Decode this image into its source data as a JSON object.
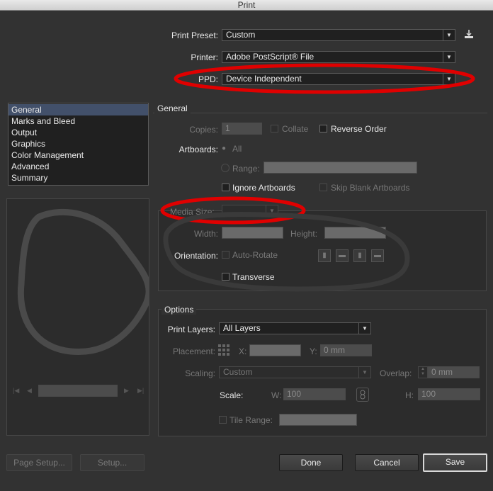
{
  "window": {
    "title": "Print"
  },
  "top": {
    "print_preset_label": "Print Preset:",
    "print_preset_value": "Custom",
    "printer_label": "Printer:",
    "printer_value": "Adobe PostScript® File",
    "ppd_label": "PPD:",
    "ppd_value": "Device Independent"
  },
  "sidebar": {
    "items": [
      "General",
      "Marks and Bleed",
      "Output",
      "Graphics",
      "Color Management",
      "Advanced",
      "Summary"
    ],
    "selected": "General"
  },
  "general": {
    "section_title": "General",
    "copies_label": "Copies:",
    "copies_value": "1",
    "collate_label": "Collate",
    "reverse_order_label": "Reverse Order",
    "artboards_label": "Artboards:",
    "all_label": "All",
    "range_label": "Range:",
    "ignore_artboards_label": "Ignore Artboards",
    "skip_blank_label": "Skip Blank Artboards",
    "media_size_label": "Media Size:",
    "width_label": "Width:",
    "height_label": "Height:",
    "orientation_label": "Orientation:",
    "auto_rotate_label": "Auto-Rotate",
    "transverse_label": "Transverse"
  },
  "options": {
    "section_title": "Options",
    "print_layers_label": "Print Layers:",
    "print_layers_value": "All Layers",
    "placement_label": "Placement:",
    "x_label": "X:",
    "y_label": "Y:",
    "y_value": "0 mm",
    "scaling_label": "Scaling:",
    "scaling_value": "Custom",
    "overlap_label": "Overlap:",
    "overlap_value": "0 mm",
    "scale_label": "Scale:",
    "w_label": "W:",
    "w_value": "100",
    "h_label": "H:",
    "h_value": "100",
    "tile_range_label": "Tile Range:"
  },
  "buttons": {
    "page_setup": "Page Setup...",
    "setup": "Setup...",
    "done": "Done",
    "cancel": "Cancel",
    "save": "Save"
  },
  "annotations": {
    "color": "#e00000"
  }
}
